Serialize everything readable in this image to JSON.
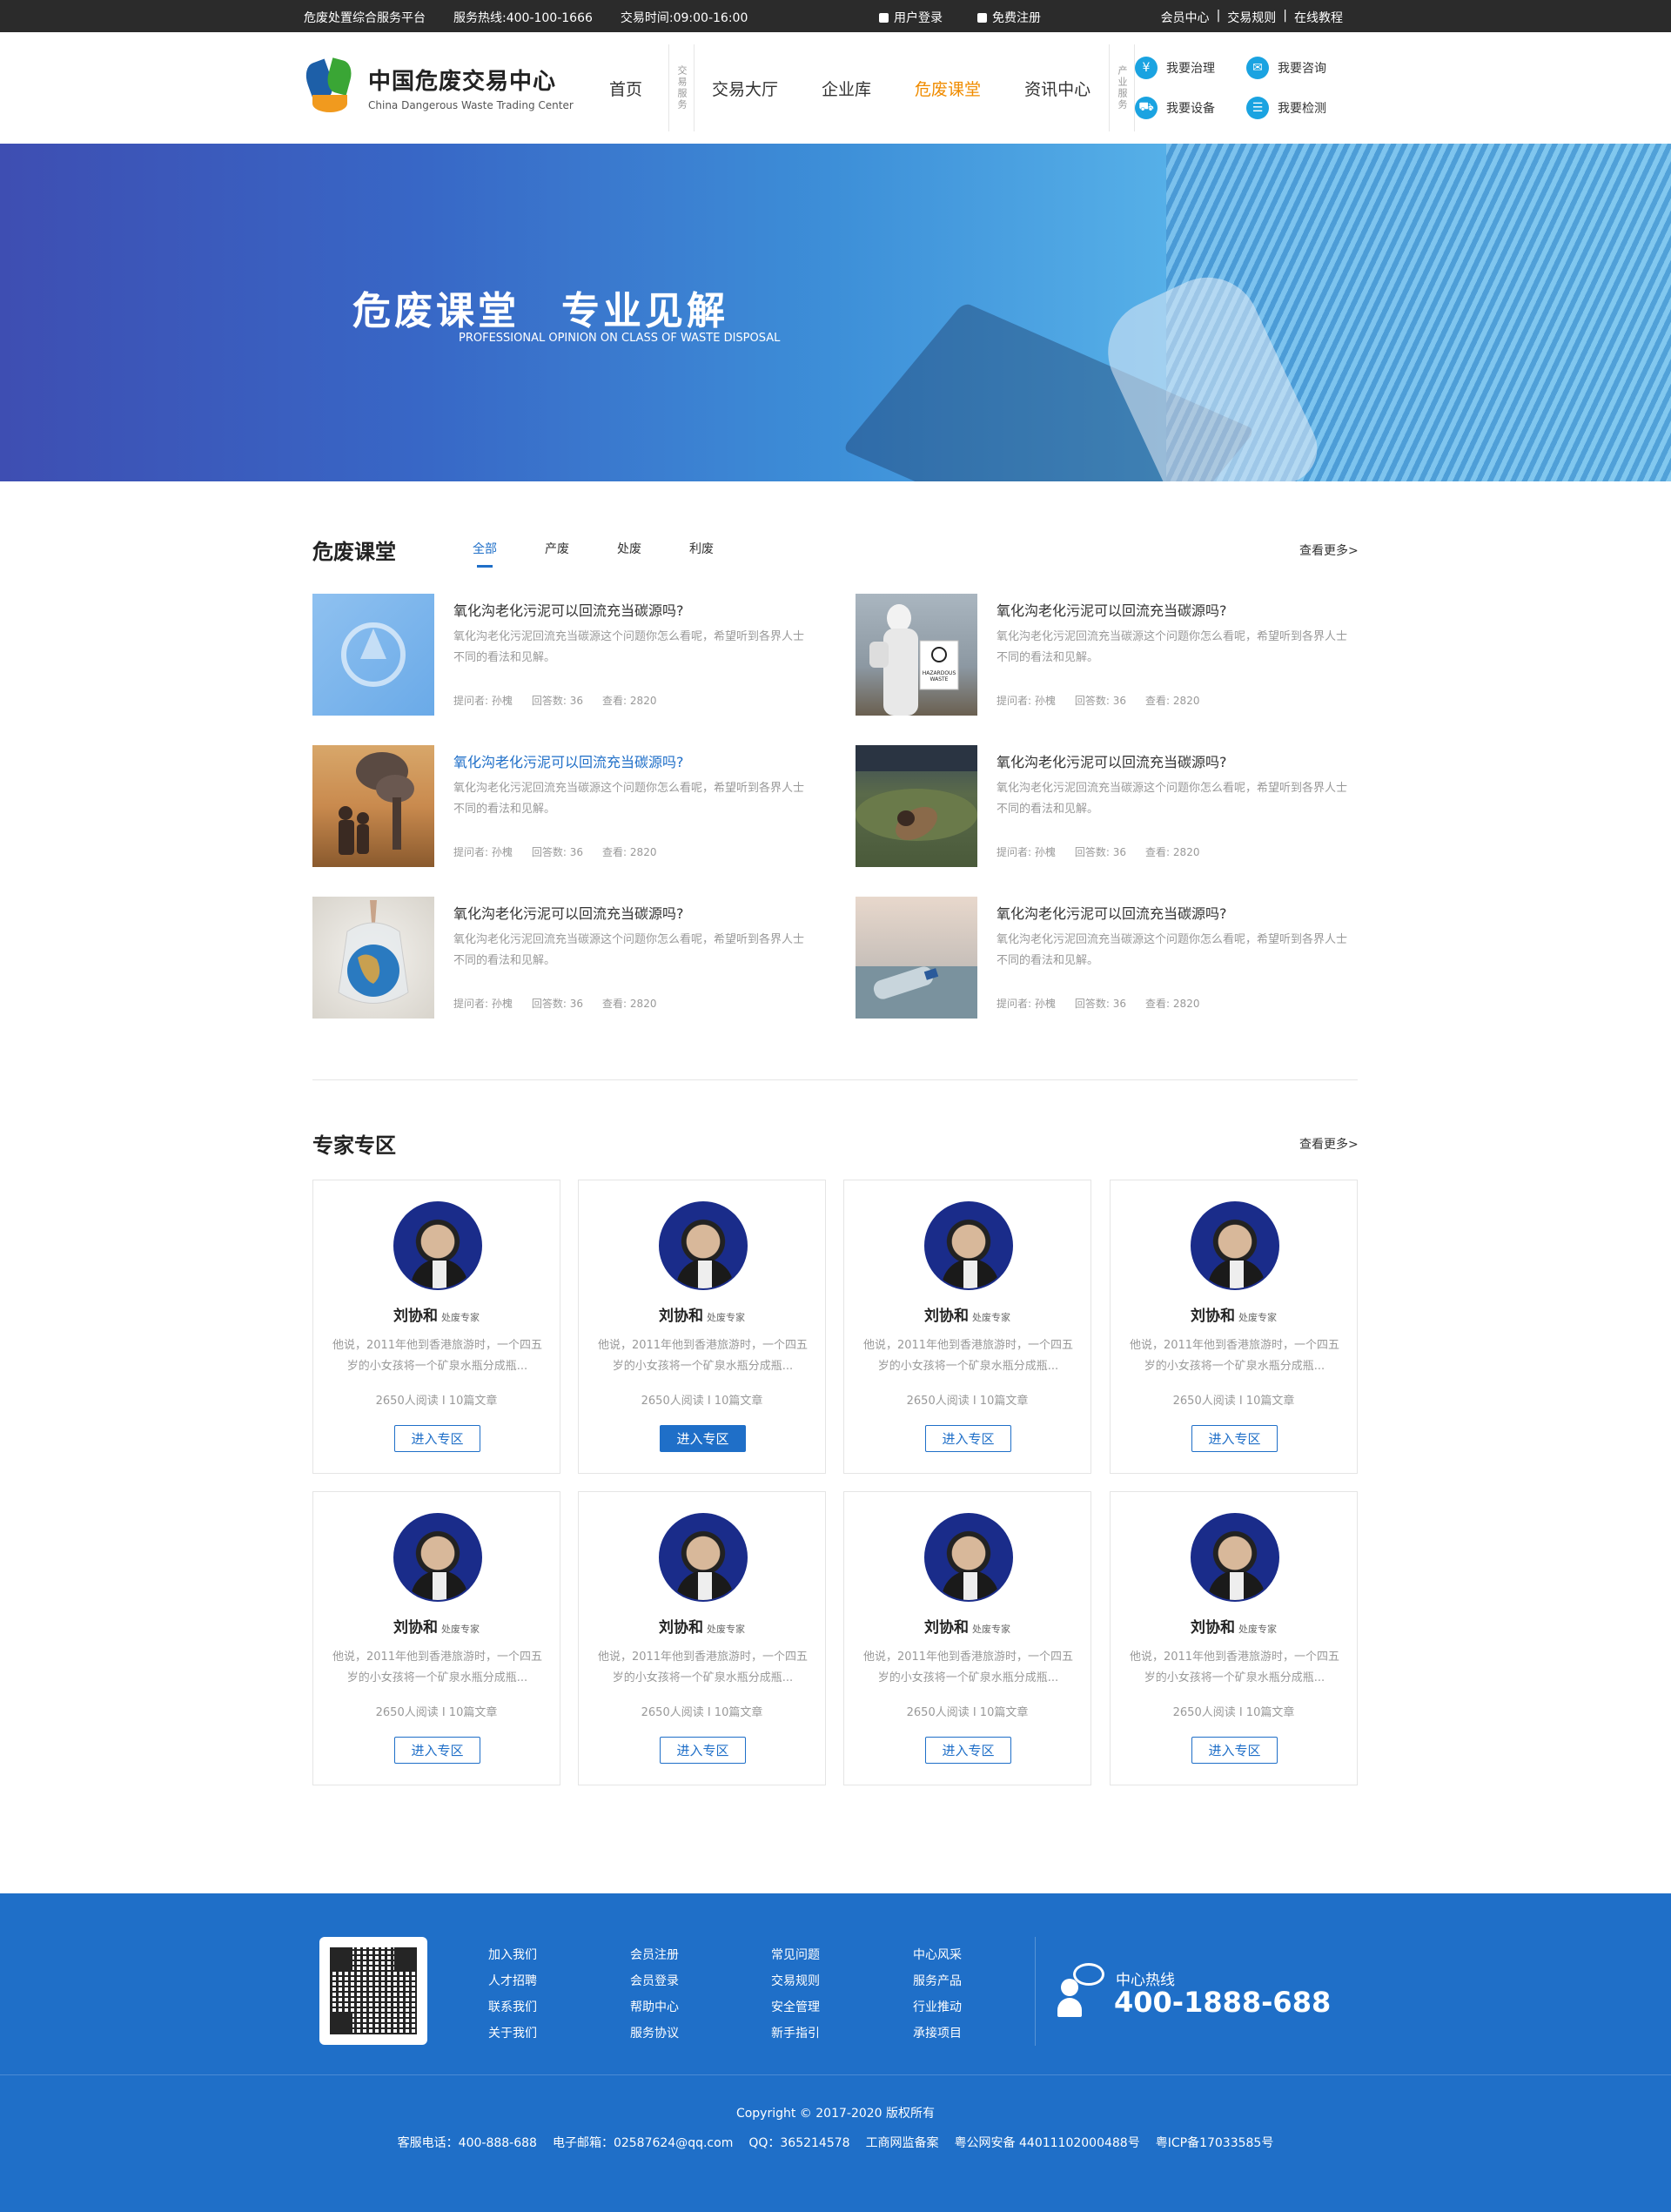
{
  "topbar": {
    "platform": "危废处置综合服务平台",
    "hotline": "服务热线:400-100-1666",
    "hours": "交易时间:09:00-16:00",
    "login": "用户登录",
    "register": "免费注册",
    "links": [
      "会员中心",
      "|",
      "交易规则",
      "|",
      "在线教程"
    ]
  },
  "logo": {
    "cn": "中国危废交易中心",
    "en": "China Dangerous Waste Trading Center"
  },
  "nav": {
    "label1": "交易服务",
    "items": [
      "首页",
      "交易大厅",
      "企业库",
      "危废课堂",
      "资讯中心"
    ],
    "active": "危废课堂",
    "label2": "产业服务"
  },
  "services": [
    {
      "label": "我要治理",
      "icon": "yuan-icon",
      "glyph": "¥"
    },
    {
      "label": "我要咨询",
      "icon": "mail-icon",
      "glyph": "✉"
    },
    {
      "label": "我要设备",
      "icon": "truck-icon",
      "glyph": "⛟"
    },
    {
      "label": "我要检测",
      "icon": "list-icon",
      "glyph": "☰"
    }
  ],
  "banner": {
    "title": "危废课堂　专业见解",
    "subtitle": "PROFESSIONAL OPINION ON  CLASS OF WASTE DISPOSAL"
  },
  "classroom": {
    "title": "危废课堂",
    "more": "查看更多>",
    "tabs": [
      "全部",
      "产废",
      "处废",
      "利废"
    ],
    "articles": [
      {
        "title": "氧化沟老化污泥可以回流充当碳源吗?",
        "desc": "氧化沟老化污泥回流充当碳源这个问题你怎么看呢，希望听到各界人士不同的看法和见解。",
        "asker": "提问者:",
        "asker_name": "孙槐",
        "answers": "回答数:",
        "answers_n": "36",
        "views": "查看:",
        "views_n": "2820",
        "image": "logo-placeholder"
      },
      {
        "title": "氧化沟老化污泥可以回流充当碳源吗?",
        "desc": "氧化沟老化污泥回流充当碳源这个问题你怎么看呢，希望听到各界人士不同的看法和见解。",
        "asker": "提问者:",
        "asker_name": "孙槐",
        "answers": "回答数:",
        "answers_n": "36",
        "views": "查看:",
        "views_n": "2820",
        "image": "hazmat-worker",
        "sign_text": "HAZARDOUS WASTE"
      },
      {
        "title": "氧化沟老化污泥可以回流充当碳源吗?",
        "desc": "氧化沟老化污泥回流充当碳源这个问题你怎么看呢，希望听到各界人士不同的看法和见解。",
        "asker": "提问者:",
        "asker_name": "孙槐",
        "answers": "回答数:",
        "answers_n": "36",
        "views": "查看:",
        "views_n": "2820",
        "image": "smokestack-children",
        "highlight": true
      },
      {
        "title": "氧化沟老化污泥可以回流充当碳源吗?",
        "desc": "氧化沟老化污泥回流充当碳源这个问题你怎么看呢，希望听到各界人士不同的看法和见解。",
        "asker": "提问者:",
        "asker_name": "孙槐",
        "answers": "回答数:",
        "answers_n": "36",
        "views": "查看:",
        "views_n": "2820",
        "image": "polluted-water"
      },
      {
        "title": "氧化沟老化污泥可以回流充当碳源吗?",
        "desc": "氧化沟老化污泥回流充当碳源这个问题你怎么看呢，希望听到各界人士不同的看法和见解。",
        "asker": "提问者:",
        "asker_name": "孙槐",
        "answers": "回答数:",
        "answers_n": "36",
        "views": "查看:",
        "views_n": "2820",
        "image": "globe-in-bag"
      },
      {
        "title": "氧化沟老化污泥可以回流充当碳源吗?",
        "desc": "氧化沟老化污泥回流充当碳源这个问题你怎么看呢，希望听到各界人士不同的看法和见解。",
        "asker": "提问者:",
        "asker_name": "孙槐",
        "answers": "回答数:",
        "answers_n": "36",
        "views": "查看:",
        "views_n": "2820",
        "image": "plastic-bottle-sea"
      }
    ]
  },
  "experts": {
    "title": "专家专区",
    "more": "查看更多>",
    "cards": [
      {
        "name": "刘协和",
        "role": "处废专家",
        "desc": "他说，2011年他到香港旅游时，一个四五岁的小女孩将一个矿泉水瓶分成瓶...",
        "stats": "2650人阅读 I 10篇文章",
        "button": "进入专区"
      },
      {
        "name": "刘协和",
        "role": "处废专家",
        "desc": "他说，2011年他到香港旅游时，一个四五岁的小女孩将一个矿泉水瓶分成瓶...",
        "stats": "2650人阅读 I 10篇文章",
        "button": "进入专区",
        "active": true
      },
      {
        "name": "刘协和",
        "role": "处废专家",
        "desc": "他说，2011年他到香港旅游时，一个四五岁的小女孩将一个矿泉水瓶分成瓶...",
        "stats": "2650人阅读 I 10篇文章",
        "button": "进入专区"
      },
      {
        "name": "刘协和",
        "role": "处废专家",
        "desc": "他说，2011年他到香港旅游时，一个四五岁的小女孩将一个矿泉水瓶分成瓶...",
        "stats": "2650人阅读 I 10篇文章",
        "button": "进入专区"
      },
      {
        "name": "刘协和",
        "role": "处废专家",
        "desc": "他说，2011年他到香港旅游时，一个四五岁的小女孩将一个矿泉水瓶分成瓶...",
        "stats": "2650人阅读 I 10篇文章",
        "button": "进入专区"
      },
      {
        "name": "刘协和",
        "role": "处废专家",
        "desc": "他说，2011年他到香港旅游时，一个四五岁的小女孩将一个矿泉水瓶分成瓶...",
        "stats": "2650人阅读 I 10篇文章",
        "button": "进入专区"
      },
      {
        "name": "刘协和",
        "role": "处废专家",
        "desc": "他说，2011年他到香港旅游时，一个四五岁的小女孩将一个矿泉水瓶分成瓶...",
        "stats": "2650人阅读 I 10篇文章",
        "button": "进入专区"
      },
      {
        "name": "刘协和",
        "role": "处废专家",
        "desc": "他说，2011年他到香港旅游时，一个四五岁的小女孩将一个矿泉水瓶分成瓶...",
        "stats": "2650人阅读 I 10篇文章",
        "button": "进入专区"
      }
    ]
  },
  "footer": {
    "columns": [
      [
        "加入我们",
        "人才招聘",
        "联系我们",
        "关于我们"
      ],
      [
        "会员注册",
        "会员登录",
        "帮助中心",
        "服务协议"
      ],
      [
        "常见问题",
        "交易规则",
        "安全管理",
        "新手指引"
      ],
      [
        "中心风采",
        "服务产品",
        "行业推动",
        "承接项目"
      ]
    ],
    "hotline_label": "中心热线",
    "hotline_number": "400-1888-688",
    "copyright": "Copyright © 2017-2020  版权所有",
    "info": [
      "客服电话：400-888-688",
      "电子邮箱：02587624@qq.com",
      "QQ：365214578",
      "工商网监备案",
      "粤公网安备 44011102000488号",
      "粤ICP备17033585号"
    ]
  },
  "colors": {
    "accent": "#1f6fc8",
    "nav_active": "#f08c00",
    "topbar_bg": "#2b2b2b",
    "footer_bg": "#1f6fc8"
  }
}
